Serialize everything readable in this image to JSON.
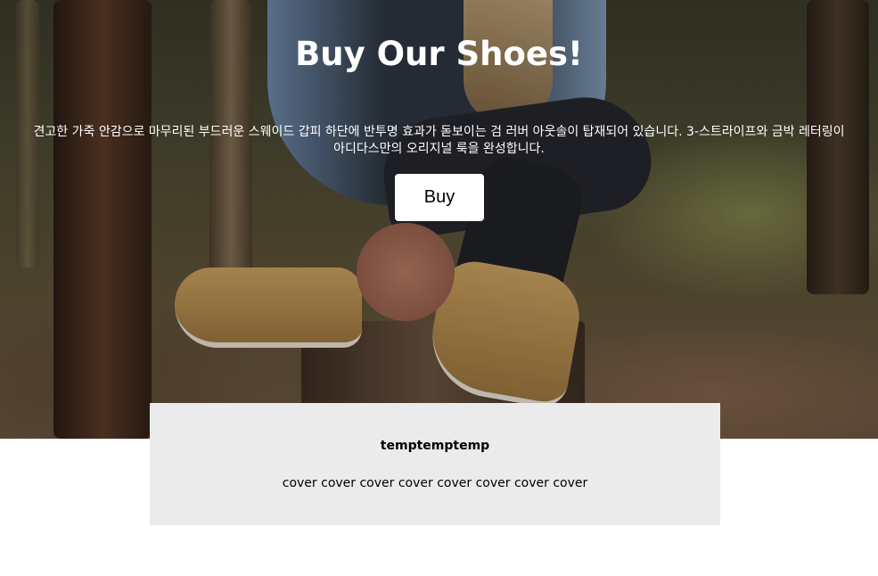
{
  "hero": {
    "title": "Buy Our Shoes!",
    "description": "견고한 가죽 안감으로 마무리된 부드러운 스웨이드 갑피 하단에 반투명 효과가 돋보이는 검 러버 아웃솔이 탑재되어 있습니다. 3-스트라이프와 금박 레터링이 아디다스만의 오리지널 룩을 완성합니다.",
    "buy_label": "Buy"
  },
  "card": {
    "title": "temptemptemp",
    "text": "cover cover cover cover cover cover cover cover"
  }
}
